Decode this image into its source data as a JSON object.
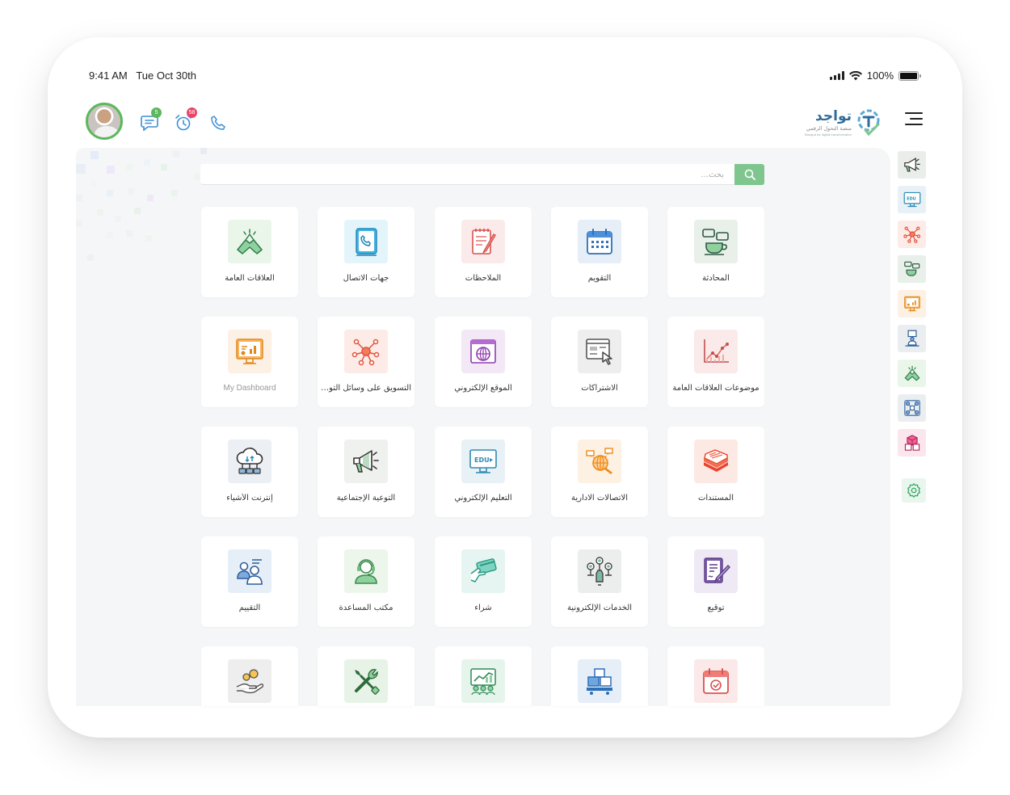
{
  "status_bar": {
    "time": "9:41 AM",
    "date": "Tue Oct 30th",
    "battery": "100%"
  },
  "header": {
    "messages_badge": "5",
    "alarms_badge": "58",
    "logo_title": "تواجد",
    "logo_subtitle": "منصة التحول الرقمي",
    "logo_tagline": "Tawajud for digital transformation"
  },
  "search": {
    "placeholder": "بحث..."
  },
  "tiles": [
    {
      "label": "المحادثة",
      "icon": "chat-coffee-icon",
      "bg": "#e9efe9"
    },
    {
      "label": "التقويم",
      "icon": "calendar-icon",
      "bg": "#e6eef8"
    },
    {
      "label": "الملاحظات",
      "icon": "notes-icon",
      "bg": "#fbeaea"
    },
    {
      "label": "جهات الاتصال",
      "icon": "contacts-book-icon",
      "bg": "#e4f4fb"
    },
    {
      "label": "العلاقات العامة",
      "icon": "handshake-icon",
      "bg": "#eaf6ea"
    },
    {
      "label": "موضوعات العلاقات العامة",
      "icon": "trend-chart-icon",
      "bg": "#fbeaea"
    },
    {
      "label": "الاشتراكات",
      "icon": "subscriptions-icon",
      "bg": "#eeeeee"
    },
    {
      "label": "الموقع الإلكتروني",
      "icon": "website-globe-icon",
      "bg": "#f3e8f6"
    },
    {
      "label": "التسويق على وسائل التواصل الاجتماعي",
      "icon": "network-nodes-icon",
      "bg": "#fcebe7"
    },
    {
      "label": "My Dashboard",
      "icon": "dashboard-screen-icon",
      "bg": "#fdf0e4"
    },
    {
      "label": "المستندات",
      "icon": "documents-stack-icon",
      "bg": "#fde9e4"
    },
    {
      "label": "الاتصالات الادارية",
      "icon": "admin-communications-icon",
      "bg": "#fdf1e4"
    },
    {
      "label": "التعليم الإلكتروني",
      "icon": "edu-monitor-icon",
      "bg": "#e8f1f5"
    },
    {
      "label": "التوعية الإجتماعية",
      "icon": "megaphone-icon",
      "bg": "#eef1ee"
    },
    {
      "label": "إنترنت الأشياء",
      "icon": "iot-cloud-icon",
      "bg": "#eceff3"
    },
    {
      "label": "توقيع",
      "icon": "signature-icon",
      "bg": "#efe8f5"
    },
    {
      "label": "الخدمات الإلكترونية",
      "icon": "e-services-icon",
      "bg": "#eceeee"
    },
    {
      "label": "شراء",
      "icon": "purchase-card-icon",
      "bg": "#e6f5f1"
    },
    {
      "label": "مكتب المساعدة",
      "icon": "helpdesk-agent-icon",
      "bg": "#ecf6ea"
    },
    {
      "label": "التقييم",
      "icon": "evaluation-people-icon",
      "bg": "#e6eef8"
    },
    {
      "label": "",
      "icon": "calendar-check-icon",
      "bg": "#fbe8e8"
    },
    {
      "label": "",
      "icon": "inventory-boxes-icon",
      "bg": "#e6eef8"
    },
    {
      "label": "",
      "icon": "analytics-team-icon",
      "bg": "#e6f5ec"
    },
    {
      "label": "",
      "icon": "tools-icon",
      "bg": "#e8f3e8"
    },
    {
      "label": "",
      "icon": "hand-coins-icon",
      "bg": "#eeeeee"
    }
  ],
  "sidebar": [
    {
      "icon": "megaphone-icon",
      "bg": "#e9eeeb"
    },
    {
      "icon": "edu-monitor-icon",
      "bg": "#e8f1f5"
    },
    {
      "icon": "network-nodes-icon",
      "bg": "#fcebe7"
    },
    {
      "icon": "chat-coffee-icon",
      "bg": "#e9efe9"
    },
    {
      "icon": "dashboard-screen-icon",
      "bg": "#fdf0e4"
    },
    {
      "icon": "presenter-icon",
      "bg": "#ebeef1"
    },
    {
      "icon": "handshake-icon",
      "bg": "#eaf6ea"
    },
    {
      "icon": "network-people-icon",
      "bg": "#ebeef1"
    },
    {
      "icon": "boxes-icon",
      "bg": "#fbe6ee"
    },
    {
      "icon": "gear-icon",
      "bg": "#e9f6ee"
    }
  ],
  "colors": {
    "accent": "#7ec68e",
    "brand": "#2f6b9a"
  }
}
